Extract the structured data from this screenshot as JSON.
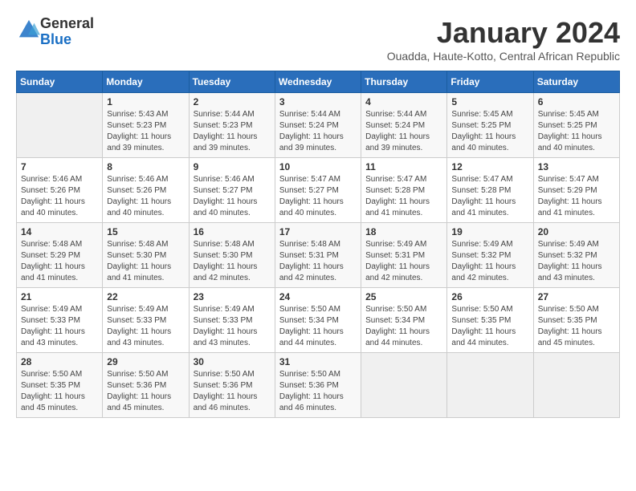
{
  "logo": {
    "general": "General",
    "blue": "Blue"
  },
  "header": {
    "month_title": "January 2024",
    "subtitle": "Ouadda, Haute-Kotto, Central African Republic"
  },
  "days_of_week": [
    "Sunday",
    "Monday",
    "Tuesday",
    "Wednesday",
    "Thursday",
    "Friday",
    "Saturday"
  ],
  "weeks": [
    [
      {
        "day": "",
        "info": ""
      },
      {
        "day": "1",
        "sunrise": "Sunrise: 5:43 AM",
        "sunset": "Sunset: 5:23 PM",
        "daylight": "Daylight: 11 hours and 39 minutes."
      },
      {
        "day": "2",
        "sunrise": "Sunrise: 5:44 AM",
        "sunset": "Sunset: 5:23 PM",
        "daylight": "Daylight: 11 hours and 39 minutes."
      },
      {
        "day": "3",
        "sunrise": "Sunrise: 5:44 AM",
        "sunset": "Sunset: 5:24 PM",
        "daylight": "Daylight: 11 hours and 39 minutes."
      },
      {
        "day": "4",
        "sunrise": "Sunrise: 5:44 AM",
        "sunset": "Sunset: 5:24 PM",
        "daylight": "Daylight: 11 hours and 39 minutes."
      },
      {
        "day": "5",
        "sunrise": "Sunrise: 5:45 AM",
        "sunset": "Sunset: 5:25 PM",
        "daylight": "Daylight: 11 hours and 40 minutes."
      },
      {
        "day": "6",
        "sunrise": "Sunrise: 5:45 AM",
        "sunset": "Sunset: 5:25 PM",
        "daylight": "Daylight: 11 hours and 40 minutes."
      }
    ],
    [
      {
        "day": "7",
        "sunrise": "Sunrise: 5:46 AM",
        "sunset": "Sunset: 5:26 PM",
        "daylight": "Daylight: 11 hours and 40 minutes."
      },
      {
        "day": "8",
        "sunrise": "Sunrise: 5:46 AM",
        "sunset": "Sunset: 5:26 PM",
        "daylight": "Daylight: 11 hours and 40 minutes."
      },
      {
        "day": "9",
        "sunrise": "Sunrise: 5:46 AM",
        "sunset": "Sunset: 5:27 PM",
        "daylight": "Daylight: 11 hours and 40 minutes."
      },
      {
        "day": "10",
        "sunrise": "Sunrise: 5:47 AM",
        "sunset": "Sunset: 5:27 PM",
        "daylight": "Daylight: 11 hours and 40 minutes."
      },
      {
        "day": "11",
        "sunrise": "Sunrise: 5:47 AM",
        "sunset": "Sunset: 5:28 PM",
        "daylight": "Daylight: 11 hours and 41 minutes."
      },
      {
        "day": "12",
        "sunrise": "Sunrise: 5:47 AM",
        "sunset": "Sunset: 5:28 PM",
        "daylight": "Daylight: 11 hours and 41 minutes."
      },
      {
        "day": "13",
        "sunrise": "Sunrise: 5:47 AM",
        "sunset": "Sunset: 5:29 PM",
        "daylight": "Daylight: 11 hours and 41 minutes."
      }
    ],
    [
      {
        "day": "14",
        "sunrise": "Sunrise: 5:48 AM",
        "sunset": "Sunset: 5:29 PM",
        "daylight": "Daylight: 11 hours and 41 minutes."
      },
      {
        "day": "15",
        "sunrise": "Sunrise: 5:48 AM",
        "sunset": "Sunset: 5:30 PM",
        "daylight": "Daylight: 11 hours and 41 minutes."
      },
      {
        "day": "16",
        "sunrise": "Sunrise: 5:48 AM",
        "sunset": "Sunset: 5:30 PM",
        "daylight": "Daylight: 11 hours and 42 minutes."
      },
      {
        "day": "17",
        "sunrise": "Sunrise: 5:48 AM",
        "sunset": "Sunset: 5:31 PM",
        "daylight": "Daylight: 11 hours and 42 minutes."
      },
      {
        "day": "18",
        "sunrise": "Sunrise: 5:49 AM",
        "sunset": "Sunset: 5:31 PM",
        "daylight": "Daylight: 11 hours and 42 minutes."
      },
      {
        "day": "19",
        "sunrise": "Sunrise: 5:49 AM",
        "sunset": "Sunset: 5:32 PM",
        "daylight": "Daylight: 11 hours and 42 minutes."
      },
      {
        "day": "20",
        "sunrise": "Sunrise: 5:49 AM",
        "sunset": "Sunset: 5:32 PM",
        "daylight": "Daylight: 11 hours and 43 minutes."
      }
    ],
    [
      {
        "day": "21",
        "sunrise": "Sunrise: 5:49 AM",
        "sunset": "Sunset: 5:33 PM",
        "daylight": "Daylight: 11 hours and 43 minutes."
      },
      {
        "day": "22",
        "sunrise": "Sunrise: 5:49 AM",
        "sunset": "Sunset: 5:33 PM",
        "daylight": "Daylight: 11 hours and 43 minutes."
      },
      {
        "day": "23",
        "sunrise": "Sunrise: 5:49 AM",
        "sunset": "Sunset: 5:33 PM",
        "daylight": "Daylight: 11 hours and 43 minutes."
      },
      {
        "day": "24",
        "sunrise": "Sunrise: 5:50 AM",
        "sunset": "Sunset: 5:34 PM",
        "daylight": "Daylight: 11 hours and 44 minutes."
      },
      {
        "day": "25",
        "sunrise": "Sunrise: 5:50 AM",
        "sunset": "Sunset: 5:34 PM",
        "daylight": "Daylight: 11 hours and 44 minutes."
      },
      {
        "day": "26",
        "sunrise": "Sunrise: 5:50 AM",
        "sunset": "Sunset: 5:35 PM",
        "daylight": "Daylight: 11 hours and 44 minutes."
      },
      {
        "day": "27",
        "sunrise": "Sunrise: 5:50 AM",
        "sunset": "Sunset: 5:35 PM",
        "daylight": "Daylight: 11 hours and 45 minutes."
      }
    ],
    [
      {
        "day": "28",
        "sunrise": "Sunrise: 5:50 AM",
        "sunset": "Sunset: 5:35 PM",
        "daylight": "Daylight: 11 hours and 45 minutes."
      },
      {
        "day": "29",
        "sunrise": "Sunrise: 5:50 AM",
        "sunset": "Sunset: 5:36 PM",
        "daylight": "Daylight: 11 hours and 45 minutes."
      },
      {
        "day": "30",
        "sunrise": "Sunrise: 5:50 AM",
        "sunset": "Sunset: 5:36 PM",
        "daylight": "Daylight: 11 hours and 46 minutes."
      },
      {
        "day": "31",
        "sunrise": "Sunrise: 5:50 AM",
        "sunset": "Sunset: 5:36 PM",
        "daylight": "Daylight: 11 hours and 46 minutes."
      },
      {
        "day": "",
        "info": ""
      },
      {
        "day": "",
        "info": ""
      },
      {
        "day": "",
        "info": ""
      }
    ]
  ]
}
